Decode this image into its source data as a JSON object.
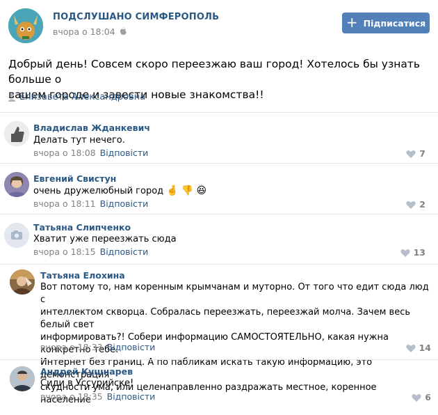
{
  "post": {
    "group_name": "ПОДСЛУШАНО СИМФЕРОПОЛЬ",
    "time": "вчора о 18:04",
    "subscribe_label": "Підписатися",
    "text_line1": "Добрый день! Совсем скоро переезжаю ваш город! Хотелось бы узнать больше о",
    "text_line2": "вашем городе и завести новые знакомства!!",
    "author": "Елизавета Александровна"
  },
  "comments": [
    {
      "name": "Владислав Жданкевич",
      "lines": [
        "Делать тут нечего."
      ],
      "time": "вчора о 18:08",
      "reply": "Відповісти",
      "likes": "7"
    },
    {
      "name": "Евгений Свистун",
      "lines": [
        "очень дружелюбный город"
      ],
      "time": "вчора о 18:11",
      "reply": "Відповісти",
      "likes": "2"
    },
    {
      "name": "Татьяна Слипченко",
      "lines": [
        "Хватит уже переезжать сюда"
      ],
      "time": "вчора о 18:15",
      "reply": "Відповісти",
      "likes": "13"
    },
    {
      "name": "Татьяна Елохина",
      "lines": [
        "Вот потому то, нам коренным крымчанам и муторно. От того что едит сюда люд с",
        "интеллектом скворца. Собралась переезжать, переезжай молча. Зачем весь белый свет",
        "информировать?! Собери информацию САМОСТОЯТЕЛЬНО, какая нужна конкретно тебе.",
        "Интернет без границ. А по пабликам искать такую информацию, это демонстрация",
        "скудности ума, или целенаправленно раздражать местное, коренное население"
      ],
      "time": "вчора о 18:33",
      "reply": "Відповісти",
      "likes": "14"
    },
    {
      "name": "Андрей Кушнарев",
      "lines": [
        "Сиди в Уссурийске!"
      ],
      "time": "вчора о 18:35",
      "reply": "Відповісти",
      "likes": "6"
    }
  ],
  "colors": {
    "link": "#2a5885",
    "button": "#5181b8",
    "meta": "#828282",
    "divider": "#e7e8ec"
  }
}
